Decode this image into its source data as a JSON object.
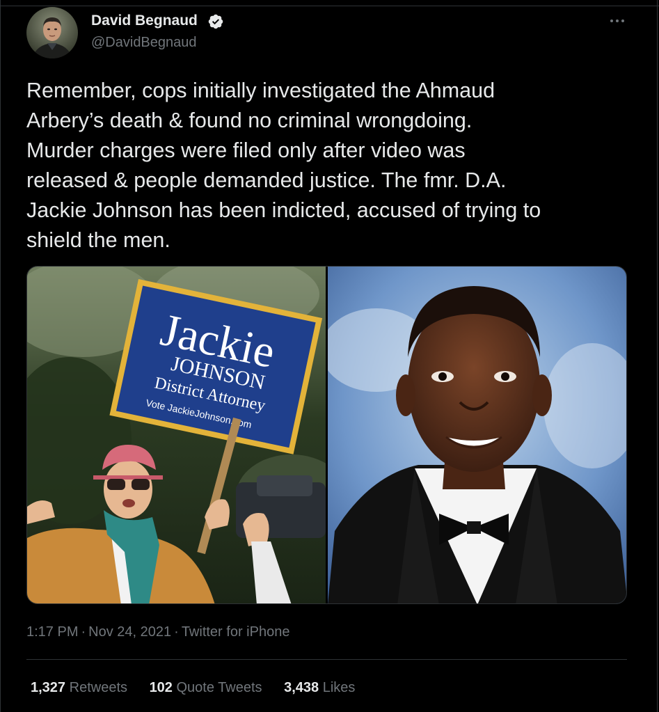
{
  "author": {
    "display_name": "David Begnaud",
    "handle": "@DavidBegnaud",
    "verified": true
  },
  "tweet": {
    "text": "Remember, cops initially investigated the Ahmaud\nArbery’s death & found no criminal wrongdoing.\nMurder charges were filed only after video was\nreleased & people demanded justice. The fmr. D.A.\nJackie Johnson has been indicted, accused of trying to\nshield the men."
  },
  "media": {
    "left_photo": {
      "sign_name": "Jackie",
      "sign_surname": "JOHNSON",
      "sign_office": "District Attorney",
      "sign_url": "Vote JackieJohnson.com"
    },
    "right_photo": {}
  },
  "meta": {
    "time": "1:17 PM",
    "date": "Nov 24, 2021",
    "separator": "·",
    "source": "Twitter for iPhone"
  },
  "stats": {
    "retweets_count": "1,327",
    "retweets_label": "Retweets",
    "quotes_count": "102",
    "quotes_label": "Quote Tweets",
    "likes_count": "3,438",
    "likes_label": "Likes"
  },
  "colors": {
    "background": "#000000",
    "text_primary": "#e7e9ea",
    "text_secondary": "#71767b",
    "divider": "#2f3336",
    "verified_badge": "#e7e9ea"
  },
  "icons": [
    "verified-badge-icon",
    "more-options-icon"
  ]
}
